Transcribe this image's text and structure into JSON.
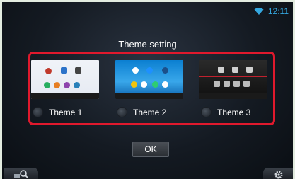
{
  "status": {
    "time": "12:11",
    "wifi_icon": "wifi-icon"
  },
  "dialog": {
    "title": "Theme setting",
    "themes": [
      {
        "label": "Theme 1"
      },
      {
        "label": "Theme 2"
      },
      {
        "label": "Theme 3"
      }
    ],
    "ok_label": "OK"
  },
  "bottom_bar": {
    "left_icon": "search-icon",
    "right_icon": "gear-icon"
  },
  "colors": {
    "accent_blue": "#35a8e0",
    "selection_red": "#e0192d",
    "background": "#141a22"
  }
}
